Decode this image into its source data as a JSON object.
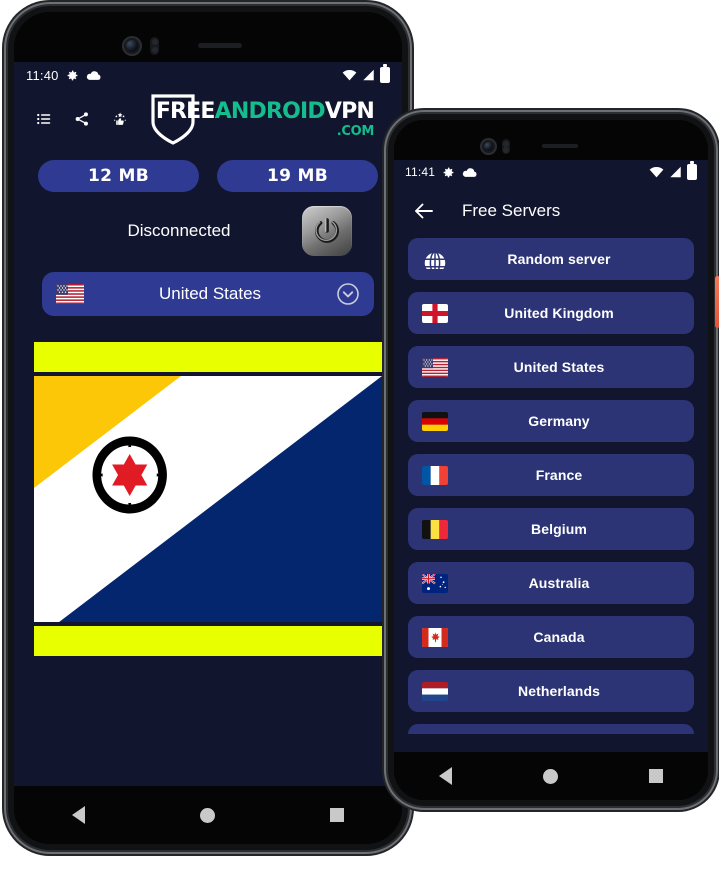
{
  "brand": {
    "logo_free": "FREE",
    "logo_android": "ANDROID",
    "logo_vpn": "VPN",
    "logo_dotcom": ".COM",
    "accent_green": "#15bd8d",
    "card_blue": "#2c3475",
    "pill_blue": "#2f3a93",
    "screen_bg": "#11152e"
  },
  "phone1": {
    "status_bar": {
      "time": "11:40",
      "icons_left": [
        "gear-icon",
        "cloud-icon"
      ],
      "icons_right": [
        "wifi-icon",
        "cellular-signal-icon",
        "battery-icon"
      ]
    },
    "toolbar": {
      "menu_label": "list-menu-icon",
      "share_label": "share-icon",
      "rate_label": "rate-us-icon"
    },
    "usage": {
      "download_label": "12 MB",
      "upload_label": "19 MB"
    },
    "connection": {
      "status_text": "Disconnected",
      "power_button_label": "power-toggle"
    },
    "server_selector": {
      "flag": "united-states-flag",
      "name": "United States",
      "chevron": "chevron-down-icon"
    },
    "banner": {
      "image_label": "bonaire-flag",
      "bar_color": "#e8ff00",
      "yellow": "#fcc707",
      "blue": "#04266f",
      "star_red": "#e01b24"
    },
    "nav": {
      "back": "back-nav-button",
      "home": "home-nav-button",
      "recent": "recent-apps-nav-button"
    }
  },
  "phone2": {
    "status_bar": {
      "time": "11:41",
      "icons_left": [
        "gear-icon",
        "cloud-icon"
      ],
      "icons_right": [
        "wifi-icon",
        "cellular-signal-icon",
        "battery-icon"
      ]
    },
    "appbar": {
      "back_label": "back-arrow-icon",
      "title": "Free Servers"
    },
    "servers": [
      {
        "name": "Random server",
        "flag": "globe"
      },
      {
        "name": "United Kingdom",
        "flag": "uk"
      },
      {
        "name": "United States",
        "flag": "us"
      },
      {
        "name": "Germany",
        "flag": "de"
      },
      {
        "name": "France",
        "flag": "fr"
      },
      {
        "name": "Belgium",
        "flag": "be"
      },
      {
        "name": "Australia",
        "flag": "au"
      },
      {
        "name": "Canada",
        "flag": "ca"
      },
      {
        "name": "Netherlands",
        "flag": "nl"
      }
    ],
    "nav": {
      "back": "back-nav-button",
      "home": "home-nav-button",
      "recent": "recent-apps-nav-button"
    }
  }
}
